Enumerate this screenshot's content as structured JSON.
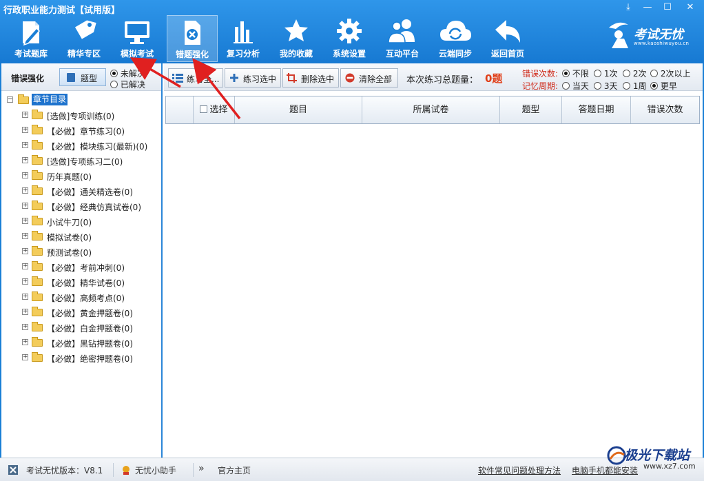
{
  "window": {
    "title": "行政职业能力测试【试用版】",
    "controls": [
      {
        "name": "download-icon",
        "glyph": "⤓"
      },
      {
        "name": "minimize-icon",
        "glyph": "—"
      },
      {
        "name": "maximize-icon",
        "glyph": "☐"
      },
      {
        "name": "close-icon",
        "glyph": "✕"
      }
    ]
  },
  "nav": {
    "items": [
      {
        "id": "kaoshitiku",
        "label": "考试题库",
        "icon": "pencil-paper-icon"
      },
      {
        "id": "jinghua",
        "label": "精华专区",
        "icon": "tag-icon"
      },
      {
        "id": "moni",
        "label": "模拟考试",
        "icon": "monitor-icon"
      },
      {
        "id": "cuoti",
        "label": "错题强化",
        "icon": "error-doc-icon",
        "active": true
      },
      {
        "id": "fuxi",
        "label": "复习分析",
        "icon": "bar-chart-icon"
      },
      {
        "id": "shoucang",
        "label": "我的收藏",
        "icon": "star-icon"
      },
      {
        "id": "shezhi",
        "label": "系统设置",
        "icon": "gear-icon"
      },
      {
        "id": "hudong",
        "label": "互动平台",
        "icon": "users-icon"
      },
      {
        "id": "yunduan",
        "label": "云端同步",
        "icon": "cloud-sync-icon"
      },
      {
        "id": "fanhui",
        "label": "返回首页",
        "icon": "back-arrow-icon"
      }
    ]
  },
  "brand": {
    "name": "考试无忧",
    "url": "www.kaoshiwuyou.cn"
  },
  "left_panel": {
    "title": "错误强化",
    "type_button": "题型",
    "filter": [
      {
        "label": "未解决",
        "checked": true
      },
      {
        "label": "已解决",
        "checked": false
      }
    ],
    "tree": {
      "root": "章节目录",
      "items": [
        "[选做]专项训练(0)",
        "【必做】章节练习(0)",
        "【必做】模块练习(最新)(0)",
        "[选做]专项练习二(0)",
        "历年真题(0)",
        "【必做】通关精选卷(0)",
        "【必做】经典仿真试卷(0)",
        "小试牛刀(0)",
        "模拟试卷(0)",
        "预测试卷(0)",
        "【必做】考前冲刺(0)",
        "【必做】精华试卷(0)",
        "【必做】高频考点(0)",
        "【必做】黄金押题卷(0)",
        "【必做】白金押题卷(0)",
        "【必做】黑钻押题卷(0)",
        "【必做】绝密押题卷(0)"
      ]
    }
  },
  "toolbar": {
    "practice_all": "练习全...",
    "practice_selected": "练习选中",
    "delete_selected": "删除选中",
    "clear_all": "清除全部",
    "total_label": "本次练习总题量：",
    "total_value": "0题",
    "error_count_label": "错误次数:",
    "error_count_options": [
      {
        "label": "不限",
        "checked": true
      },
      {
        "label": "1次",
        "checked": false
      },
      {
        "label": "2次",
        "checked": false
      },
      {
        "label": "2次以上",
        "checked": false
      }
    ],
    "memory_label": "记忆周期:",
    "memory_options": [
      {
        "label": "当天",
        "checked": false
      },
      {
        "label": "3天",
        "checked": false
      },
      {
        "label": "1周",
        "checked": false
      },
      {
        "label": "更早",
        "checked": true
      }
    ]
  },
  "table": {
    "columns": [
      "",
      "选择",
      "题目",
      "所属试卷",
      "题型",
      "答题日期",
      "错误次数"
    ]
  },
  "status_bar": {
    "version": "考试无忧版本：V8.1",
    "helper": "无忧小助手",
    "homepage": "官方主页",
    "faq": "软件常见问题处理方法",
    "install": "电脑手机都能安装"
  },
  "watermark": {
    "text": "极光下载站",
    "url": "www.xz7.com"
  },
  "colors": {
    "accent": "#1a7fd6",
    "highlight": "#e0401a",
    "arrow": "#e02020"
  }
}
